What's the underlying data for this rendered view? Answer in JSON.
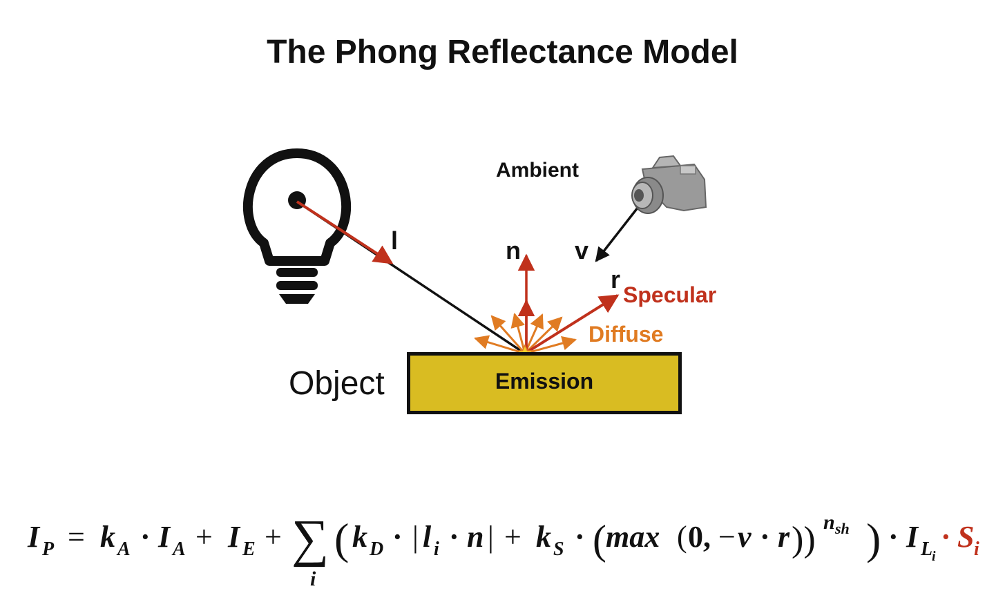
{
  "title": "The Phong Reflectance Model",
  "labels": {
    "ambient": "Ambient",
    "l": "l",
    "n": "n",
    "v": "v",
    "r": "r",
    "specular": "Specular",
    "diffuse": "Diffuse",
    "object": "Object",
    "emission": "Emission"
  },
  "icons": [
    "light-bulb-icon",
    "camera-icon",
    "star-icon"
  ],
  "colors": {
    "red": "#c0311c",
    "orange": "#e07b22",
    "object_fill": "#d9bc22",
    "black": "#111111"
  },
  "formula": {
    "I": "I",
    "P": "P",
    "eq": "=",
    "kA": "k",
    "A": "A",
    "dot": "·",
    "IA": "I",
    "plus": "+",
    "IE": "I",
    "E": "E",
    "sum": "∑",
    "i": "i",
    "kD": "k",
    "D": "D",
    "bar": "|",
    "l": "l",
    "n": "n",
    "kS": "k",
    "S": "S",
    "max": "max",
    "open": "(",
    "zero": "0,",
    "minus": "−",
    "v": "v",
    "r": "r",
    "close2": "))",
    "nsh": "n",
    "sh": "sh",
    "IL": "I",
    "L": "L",
    "Si": "S"
  }
}
